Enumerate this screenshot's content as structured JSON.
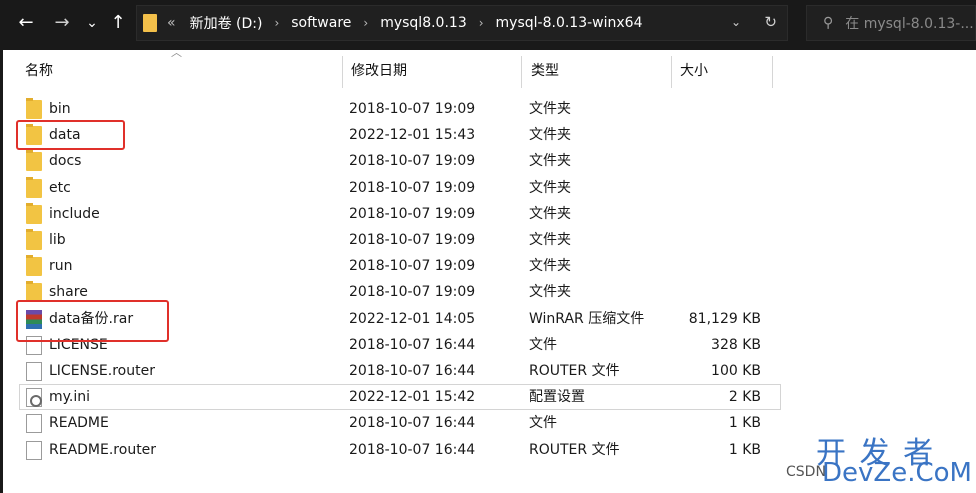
{
  "nav": {
    "back": "←",
    "forward": "→",
    "recent": "⌄",
    "up": "↑",
    "history_sep": "«",
    "breadcrumbs": [
      "新加卷 (D:)",
      "software",
      "mysql8.0.13",
      "mysql-8.0.13-winx64"
    ],
    "crumb_sep": "›",
    "dropdown": "⌄",
    "refresh": "↻",
    "search_placeholder": "在 mysql-8.0.13-..."
  },
  "columns": {
    "name": "名称",
    "date": "修改日期",
    "type": "类型",
    "size": "大小"
  },
  "files": [
    {
      "name": "bin",
      "date": "2018-10-07 19:09",
      "type": "文件夹",
      "size": "",
      "icon": "folder-icon"
    },
    {
      "name": "data",
      "date": "2022-12-01 15:43",
      "type": "文件夹",
      "size": "",
      "icon": "folder-icon"
    },
    {
      "name": "docs",
      "date": "2018-10-07 19:09",
      "type": "文件夹",
      "size": "",
      "icon": "folder-icon"
    },
    {
      "name": "etc",
      "date": "2018-10-07 19:09",
      "type": "文件夹",
      "size": "",
      "icon": "folder-icon"
    },
    {
      "name": "include",
      "date": "2018-10-07 19:09",
      "type": "文件夹",
      "size": "",
      "icon": "folder-icon"
    },
    {
      "name": "lib",
      "date": "2018-10-07 19:09",
      "type": "文件夹",
      "size": "",
      "icon": "folder-icon"
    },
    {
      "name": "run",
      "date": "2018-10-07 19:09",
      "type": "文件夹",
      "size": "",
      "icon": "folder-icon"
    },
    {
      "name": "share",
      "date": "2018-10-07 19:09",
      "type": "文件夹",
      "size": "",
      "icon": "folder-icon"
    },
    {
      "name": "data备份.rar",
      "date": "2022-12-01 14:05",
      "type": "WinRAR 压缩文件",
      "size": "81,129 KB",
      "icon": "winrar-icon"
    },
    {
      "name": "LICENSE",
      "date": "2018-10-07 16:44",
      "type": "文件",
      "size": "328 KB",
      "icon": "file-icon"
    },
    {
      "name": "LICENSE.router",
      "date": "2018-10-07 16:44",
      "type": "ROUTER 文件",
      "size": "100 KB",
      "icon": "file-icon"
    },
    {
      "name": "my.ini",
      "date": "2022-12-01 15:42",
      "type": "配置设置",
      "size": "2 KB",
      "icon": "settings-file-icon"
    },
    {
      "name": "README",
      "date": "2018-10-07 16:44",
      "type": "文件",
      "size": "1 KB",
      "icon": "file-icon"
    },
    {
      "name": "README.router",
      "date": "2018-10-07 16:44",
      "type": "ROUTER 文件",
      "size": "1 KB",
      "icon": "file-icon"
    }
  ],
  "watermark": {
    "line1": "开 发 者",
    "line2": "DevZe.CoM",
    "prefix": "CSDN"
  },
  "colors": {
    "highlight": "#e0302a",
    "folder": "#f2c443",
    "titlebar": "#191919"
  }
}
